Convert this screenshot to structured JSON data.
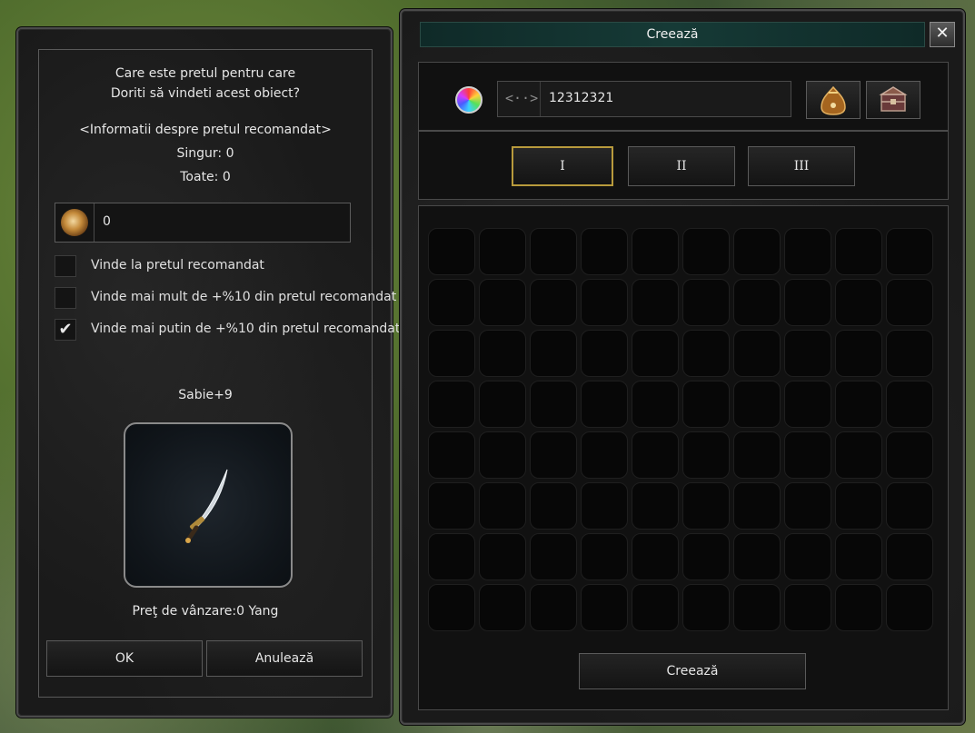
{
  "sell_dialog": {
    "question_line1": "Care este pretul pentru care",
    "question_line2": "Doriti să vindeti acest obiect?",
    "info_header": "<Informatii despre pretul recomandat>",
    "single_text": "Singur: 0",
    "all_text": "Toate: 0",
    "price_input_value": "0",
    "options": [
      {
        "label": "Vinde la pretul recomandat",
        "checked": false
      },
      {
        "label": "Vinde mai mult de +%10 din pretul recomandat",
        "checked": false
      },
      {
        "label": "Vinde mai putin de +%10 din pretul recomandat",
        "checked": true
      }
    ],
    "check_mark": "✔",
    "item_name": "Sabie+9",
    "item_icon": "sword-icon",
    "sale_price_text": "Preţ de vânzare:0 Yang",
    "ok_label": "OK",
    "cancel_label": "Anulează"
  },
  "create_window": {
    "title": "Creează",
    "close_glyph": "✕",
    "arrows_glyph": "<··>",
    "name_value": "12312321",
    "tabs": [
      {
        "label": "I",
        "active": true
      },
      {
        "label": "II",
        "active": false
      },
      {
        "label": "III",
        "active": false
      }
    ],
    "grid_columns": 10,
    "grid_rows": 8,
    "create_label": "Creează"
  },
  "colors": {
    "active_tab_border": "#b89a3c",
    "titlebar": "#163a36"
  }
}
